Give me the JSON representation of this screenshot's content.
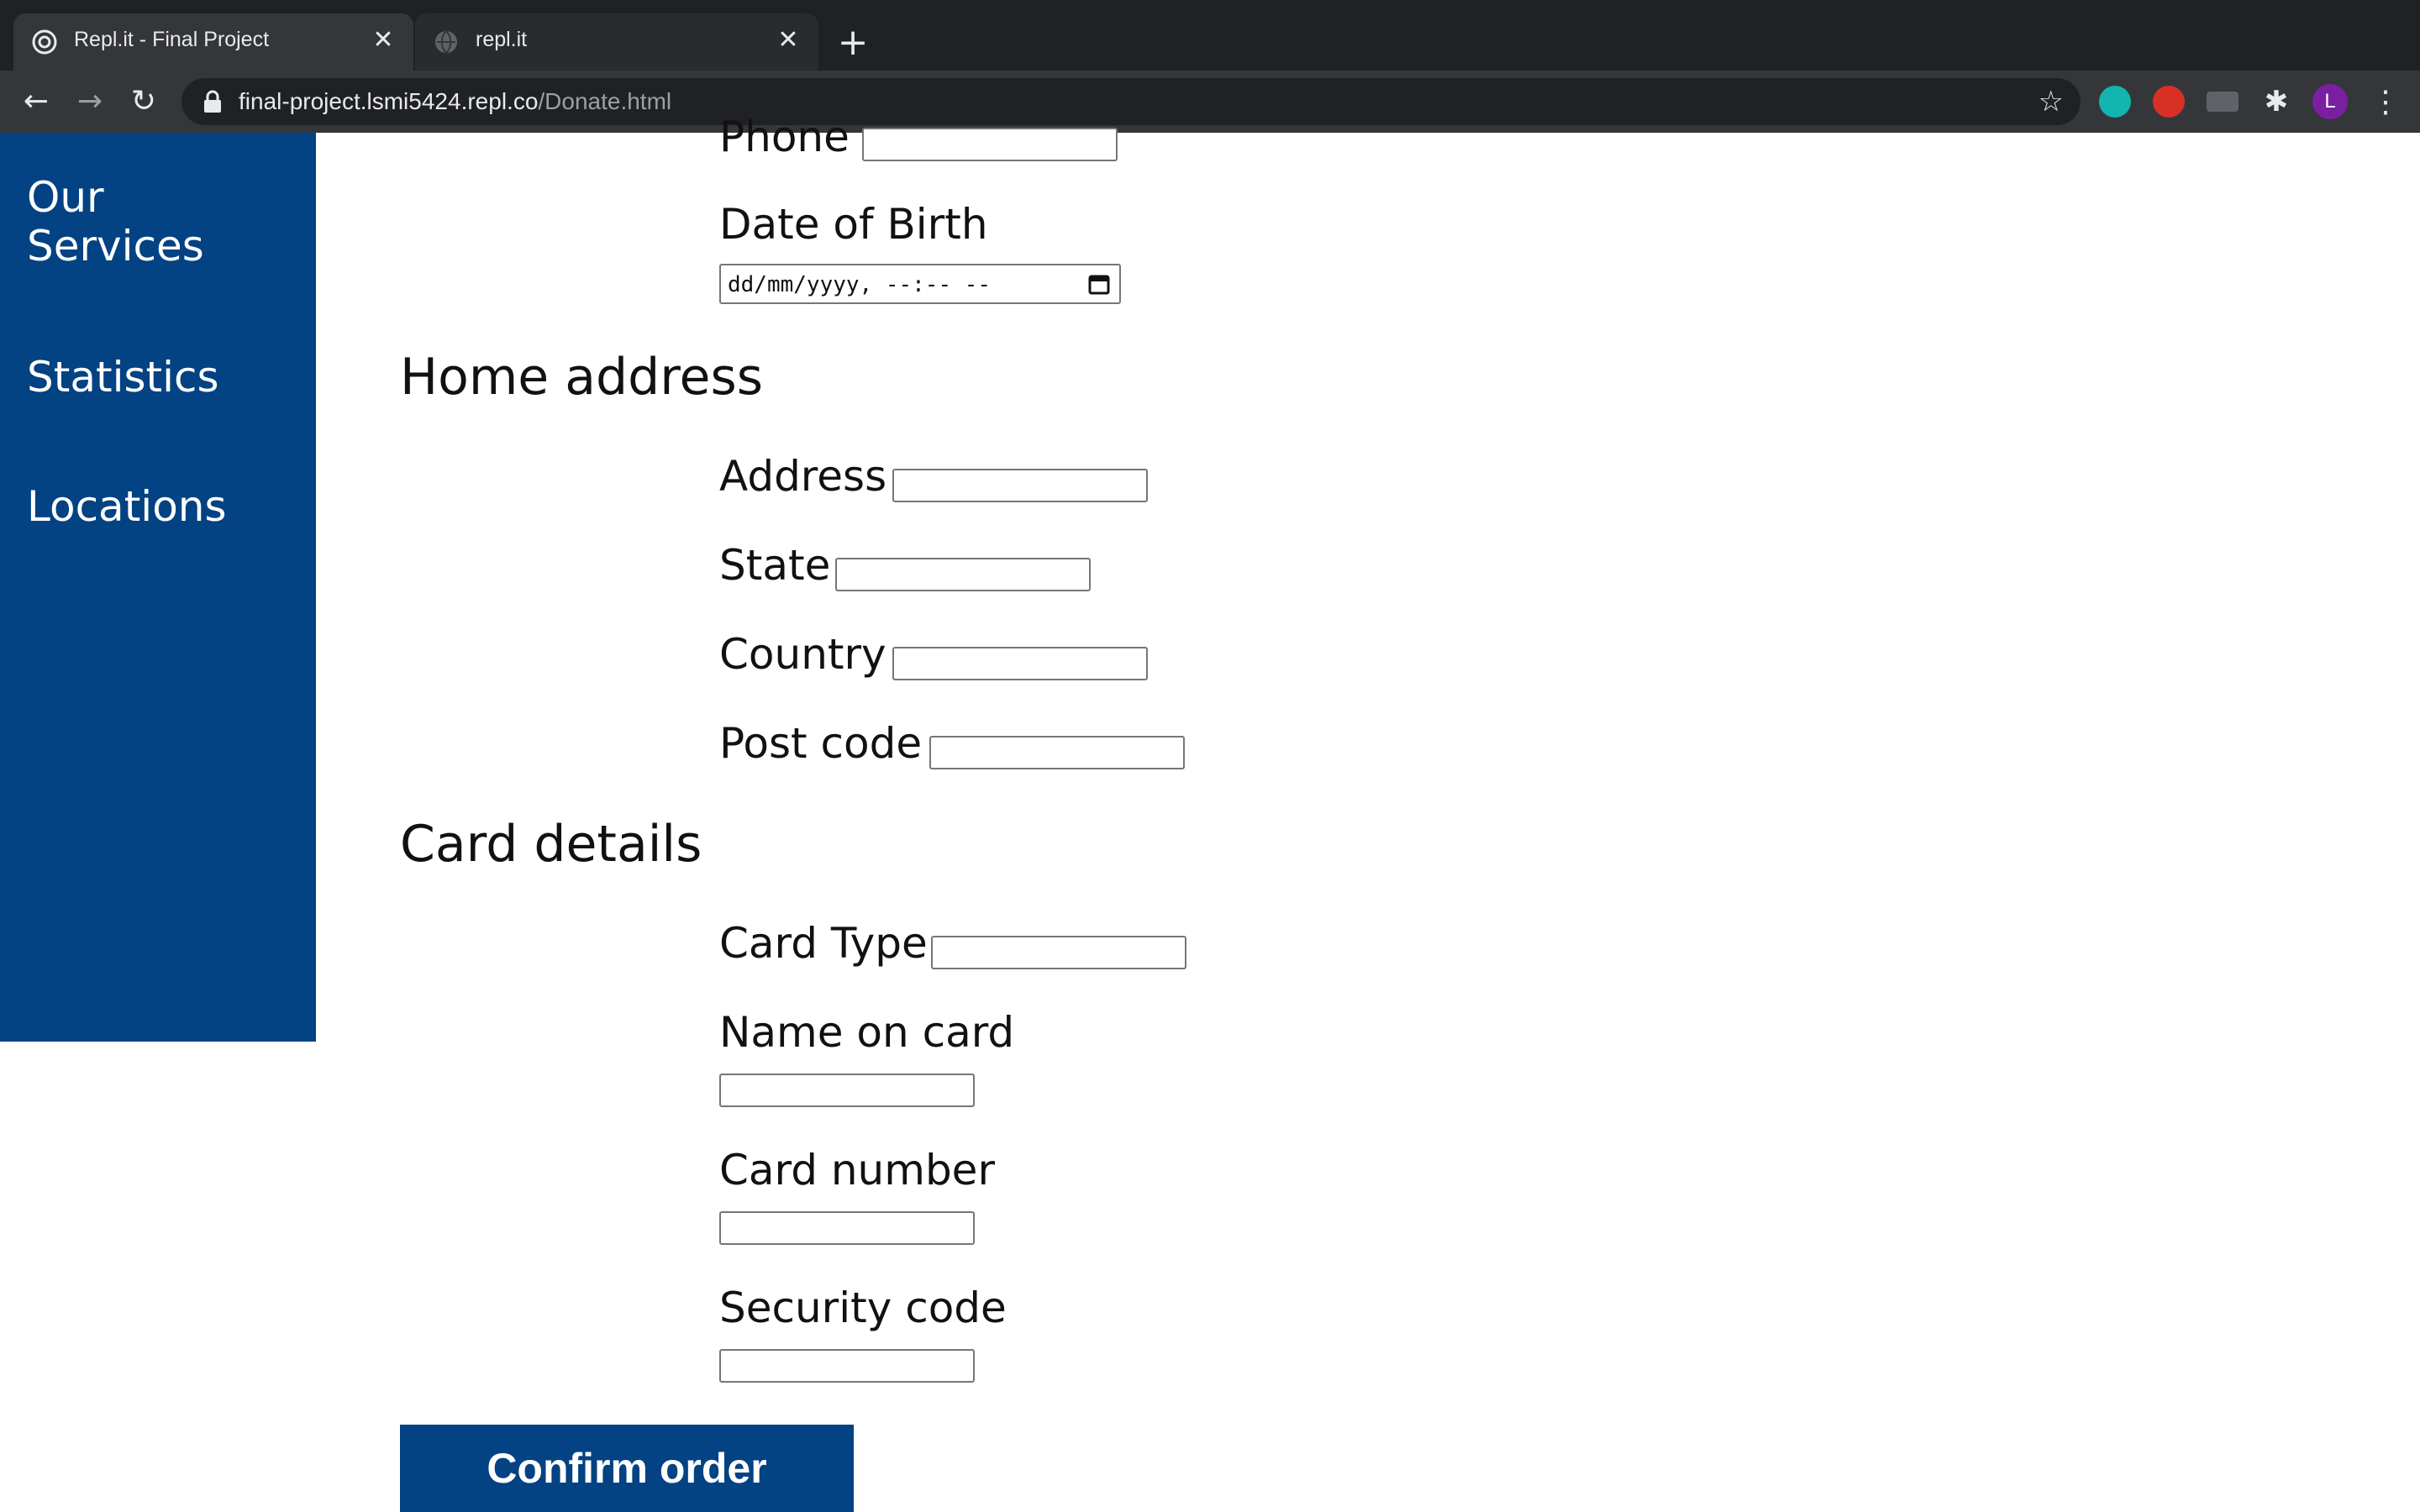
{
  "browser": {
    "tabs": [
      {
        "title": "Repl.it - Final Project"
      },
      {
        "title": "repl.it"
      }
    ],
    "url": {
      "host": "final-project.lsmi5424.repl.co",
      "path": "/Donate.html"
    },
    "profile_initial": "L",
    "accent_colors": {
      "ext_m": "#12b5b0",
      "ext_red": "#d93025",
      "profile": "#7b1fa2"
    }
  },
  "sidebar": {
    "items": [
      {
        "label": "Our\nServices"
      },
      {
        "label": "Statistics"
      },
      {
        "label": "Locations"
      }
    ],
    "color": "#034283"
  },
  "form": {
    "phone_label": "Phone",
    "dob_label": "Date of Birth",
    "dob_placeholder": "dd/mm/yyyy, --:-- --",
    "home_address_heading": "Home address",
    "address_label": "Address",
    "state_label": "State",
    "country_label": "Country",
    "postcode_label": "Post code",
    "card_details_heading": "Card details",
    "card_type_label": "Card Type",
    "name_on_card_label": "Name on card",
    "card_number_label": "Card number",
    "security_code_label": "Security code",
    "confirm_label": "Confirm order"
  }
}
